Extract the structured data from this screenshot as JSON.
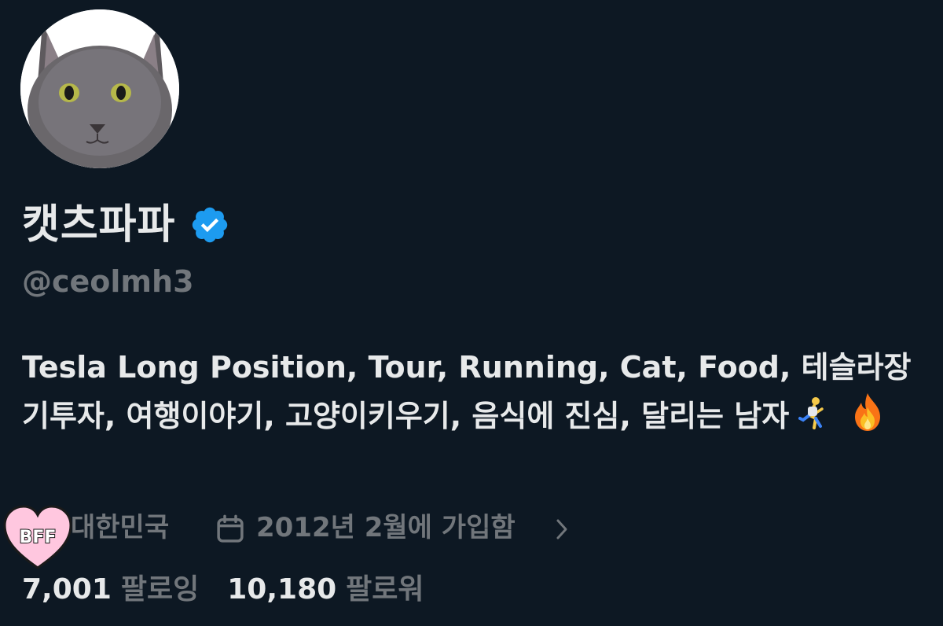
{
  "profile": {
    "display_name": "캣츠파파",
    "verified": true,
    "handle": "@ceolmh3",
    "bio_text": "Tesla Long Position, Tour, Running, Cat, Food, 테슬라장기투자, 여행이야기, 고양이키우기, 음식에 진심, 달리는 남자",
    "bio_emojis": [
      "runner-icon",
      "fire-icon"
    ]
  },
  "meta": {
    "location": "대한민국",
    "joined": "2012년 2월에 가입함",
    "sticker_text": "BFF"
  },
  "stats": {
    "following_count": "7,001",
    "following_label": "팔로잉",
    "followers_count": "10,180",
    "followers_label": "팔로워"
  },
  "colors": {
    "background": "#0d1823",
    "primary_text": "#e7e9ea",
    "secondary_text": "#71767b",
    "verified_blue": "#1d9bf0",
    "sticker_pink": "#ffc7df"
  }
}
